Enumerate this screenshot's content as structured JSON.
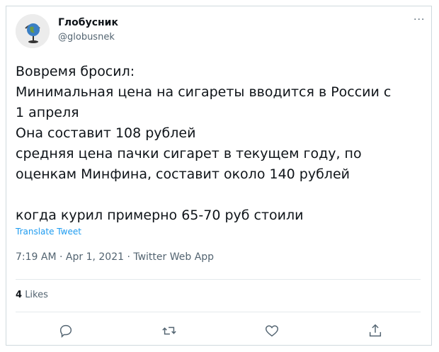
{
  "user": {
    "display_name": "Глобусник",
    "handle": "@globusnek",
    "avatar_icon": "globe-icon"
  },
  "more_label": "···",
  "tweet": {
    "text": "Вовремя бросил:\nМинимальная цена на сигареты вводится в России с\n1 апреля\nОна составит 108 рублей\nсредняя цена пачки сигарет в текущем году, по\nоценкам Минфина, составит около 140 рублей\n\nкогда курил примерно 65-70 руб стоили",
    "translate_label": "Translate Tweet",
    "meta": "7:19 AM · Apr 1, 2021 · Twitter Web App"
  },
  "stats": {
    "likes_count": "4",
    "likes_label": "Likes"
  },
  "actions": [
    {
      "icon": "reply-icon"
    },
    {
      "icon": "retweet-icon"
    },
    {
      "icon": "like-icon"
    },
    {
      "icon": "share-icon"
    }
  ],
  "colors": {
    "text": "#0f1419",
    "secondary": "#536471",
    "link": "#1d9bf0",
    "border": "#cfd9de"
  }
}
